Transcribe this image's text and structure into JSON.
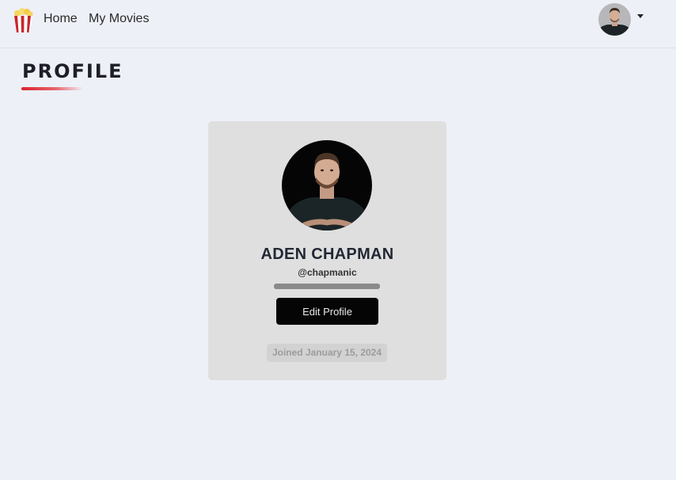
{
  "nav": {
    "home_label": "Home",
    "movies_label": "My Movies",
    "logo_icon": "popcorn-icon",
    "avatar_icon": "user-avatar",
    "caret_icon": "caret-down-icon"
  },
  "page": {
    "title": "PROFILE",
    "accent_color": "#d9232e"
  },
  "profile": {
    "name": "ADEN CHAPMAN",
    "handle": "@chapmanic",
    "edit_label": "Edit Profile",
    "joined": "Joined January 15, 2024"
  }
}
